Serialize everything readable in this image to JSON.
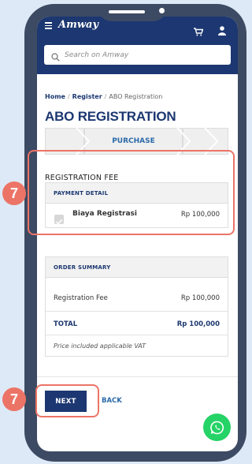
{
  "app": {
    "logo_text": "Amway"
  },
  "search": {
    "placeholder": "Search on Amway"
  },
  "breadcrumb": {
    "items": [
      "Home",
      "Register",
      "ABO Registration"
    ],
    "separator": "/"
  },
  "page": {
    "title": "ABO REGISTRATION"
  },
  "stepper": {
    "active_label": "PURCHASE"
  },
  "registration_fee": {
    "section_title": "REGISTRATION FEE",
    "payment_detail_header": "PAYMENT DETAIL",
    "item_label": "Biaya Registrasi",
    "item_amount": "Rp 100,000",
    "item_checked": true
  },
  "order_summary": {
    "header": "ORDER SUMMARY",
    "fee_label": "Registration Fee",
    "fee_amount": "Rp 100,000",
    "total_label": "TOTAL",
    "total_amount": "Rp 100,000",
    "note": "Price included applicable VAT"
  },
  "actions": {
    "next_label": "NEXT",
    "back_label": "BACK"
  },
  "annotations": {
    "step_number_1": "7",
    "step_number_2": "7"
  },
  "colors": {
    "brand_navy": "#1c3771",
    "highlight": "#ec7466",
    "whatsapp": "#25d366"
  },
  "icons": [
    "menu-icon",
    "cart-icon",
    "user-icon",
    "search-icon",
    "checkbox-icon",
    "whatsapp-icon"
  ]
}
